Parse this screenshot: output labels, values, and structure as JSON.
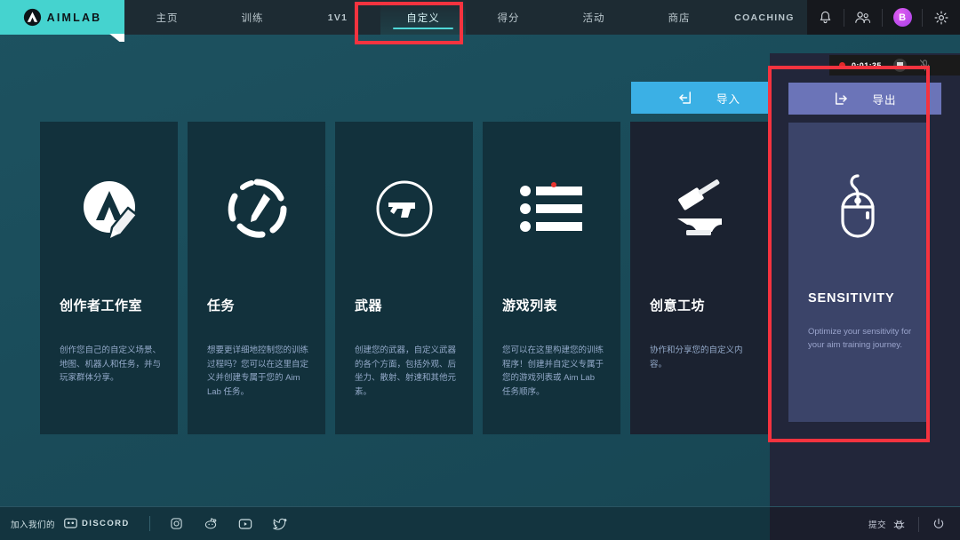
{
  "app": {
    "logo_text": "AIMLAB",
    "logo_icon": "aimlab-logo-icon"
  },
  "nav": {
    "tabs": [
      {
        "label": "主页",
        "active": false,
        "latin": false
      },
      {
        "label": "训练",
        "active": false,
        "latin": false
      },
      {
        "label": "1V1",
        "active": false,
        "latin": true
      },
      {
        "label": "自定义",
        "active": true,
        "latin": false
      },
      {
        "label": "得分",
        "active": false,
        "latin": false
      },
      {
        "label": "活动",
        "active": false,
        "latin": false
      },
      {
        "label": "商店",
        "active": false,
        "latin": false
      },
      {
        "label": "COACHING",
        "active": false,
        "latin": true
      }
    ],
    "right_icons": [
      {
        "name": "bell-icon"
      },
      {
        "name": "friends-icon"
      },
      {
        "name": "avatar"
      },
      {
        "name": "gear-icon"
      }
    ],
    "avatar_initial": "B"
  },
  "toolbar": {
    "import_label": "导入",
    "import_icon": "import-arrow-icon",
    "export_label": "导出",
    "export_icon": "export-arrow-icon"
  },
  "cards": [
    {
      "id": "creator-studio",
      "icon": "aimlab-pencil-icon",
      "title": "创作者工作室",
      "desc": "创作您自己的自定义场景、地图、机器人和任务，并与玩家群体分享。"
    },
    {
      "id": "tasks",
      "icon": "dashed-circle-pencil-icon",
      "title": "任务",
      "desc": "想要更详细地控制您的训练过程吗？您可以在这里自定义并创建专属于您的 Aim Lab 任务。"
    },
    {
      "id": "weapons",
      "icon": "pistol-circle-icon",
      "title": "武器",
      "desc": "创建您的武器，自定义武器的各个方面，包括外观、后坐力、散射、射速和其他元素。"
    },
    {
      "id": "playlists",
      "icon": "bullet-list-icon",
      "title": "游戏列表",
      "desc": "您可以在这里构建您的训练程序！创建并自定义专属于您的游戏列表或 Aim Lab 任务顺序。"
    },
    {
      "id": "workshop",
      "icon": "hammer-anvil-icon",
      "title": "创意工坊",
      "desc": "协作和分享您的自定义内容。"
    }
  ],
  "sensitivity_card": {
    "id": "sensitivity",
    "icon": "computer-mouse-icon",
    "title": "SENSITIVITY",
    "desc": "Optimize your sensitivity for your aim training journey."
  },
  "recorder": {
    "time": "0:01:35",
    "stop_icon": "stop-square-icon",
    "mic_icon": "mic-muted-icon",
    "rec_dot": "recording-dot-icon"
  },
  "footer": {
    "join_label": "加入我们的",
    "discord_label": "DISCORD",
    "discord_icon": "discord-icon",
    "socials": [
      {
        "name": "instagram-icon"
      },
      {
        "name": "reddit-icon"
      },
      {
        "name": "youtube-icon"
      },
      {
        "name": "twitter-icon"
      }
    ],
    "submit_label": "提交",
    "bug_icon": "bug-icon",
    "power_icon": "power-icon"
  },
  "colors": {
    "brand_teal": "#45d3cf",
    "page_bg": "#1a4c5a",
    "card_bg": "#12313c",
    "import_blue": "#3bb0e5",
    "export_purple": "#6b74b8",
    "sens_card_bg": "#3b4469",
    "annotation_red": "#f5333f",
    "accent_underline": "#4fd8d8"
  }
}
